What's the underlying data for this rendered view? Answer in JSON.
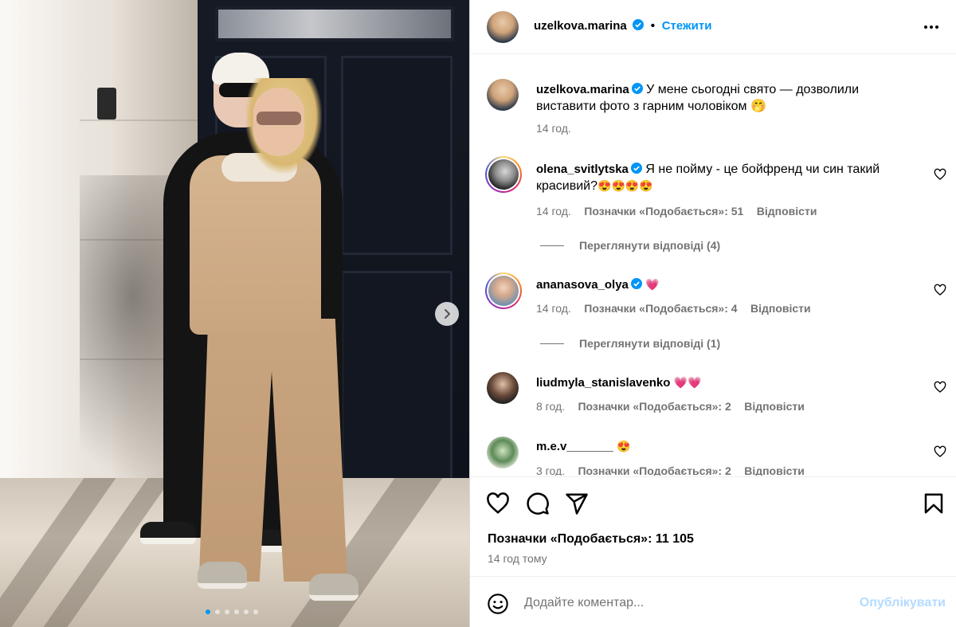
{
  "post": {
    "author": "uzelkova.marina",
    "follow_label": "Стежити",
    "separator": "•",
    "caption_line1": "У мене сьогодні свято — дозволили",
    "caption_line2": "виставити фото з гарним чоловіком 🤭",
    "caption_time": "14 год.",
    "likes_label": "Позначки «Подобається»: 11 105",
    "time_ago": "14 год тому",
    "comment_placeholder": "Додайте коментар...",
    "publish_label": "Опублікувати",
    "carousel": {
      "slide_count": 6,
      "active_index": 0
    }
  },
  "comments": [
    {
      "user": "olena_svitlytska",
      "verified": true,
      "text_line1": "Я не пойму - це бойфренд чи син такий",
      "text_line2": "красивий?",
      "emojis": "😍😍😍😍",
      "time": "14 год.",
      "likes": "Позначки «Подобається»: 51",
      "reply": "Відповісти",
      "view_replies": "Переглянути відповіді (4)"
    },
    {
      "user": "ananasova_olya",
      "verified": true,
      "text_line1": "",
      "emojis": "💗",
      "time": "14 год.",
      "likes": "Позначки «Подобається»: 4",
      "reply": "Відповісти",
      "view_replies": "Переглянути відповіді (1)"
    },
    {
      "user": "liudmyla_stanislavenko",
      "verified": false,
      "emojis": "💗💗",
      "time": "8 год.",
      "likes": "Позначки «Подобається»: 2",
      "reply": "Відповісти"
    },
    {
      "user": "m.e.v_______",
      "verified": false,
      "emojis": "😍",
      "time": "3 год.",
      "likes": "Позначки «Подобається»: 2",
      "reply": "Відповісти"
    }
  ],
  "icons": {
    "more": "more-options-icon",
    "like": "heart-icon",
    "comment": "comment-icon",
    "share": "share-icon",
    "save": "bookmark-icon",
    "emoji": "emoji-icon",
    "next": "chevron-right-icon",
    "verified": "verified-badge-icon"
  },
  "colors": {
    "accent": "#0095f6",
    "muted": "#737373",
    "publish_disabled": "#b3dbff"
  }
}
